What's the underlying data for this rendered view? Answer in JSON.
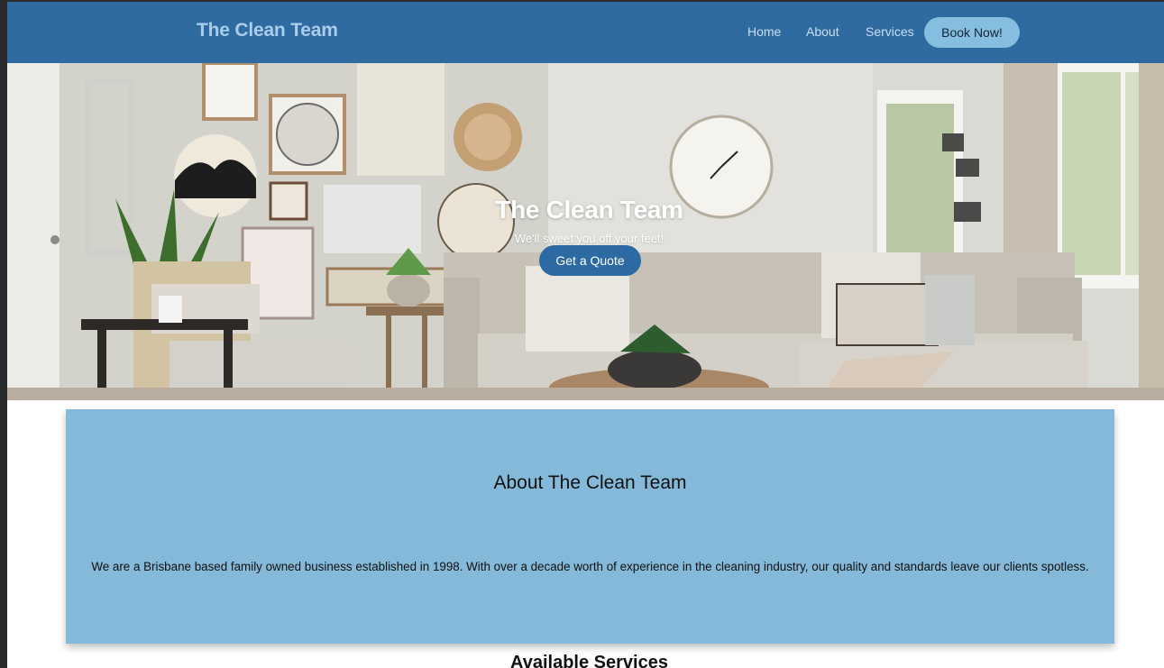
{
  "navbar": {
    "brand": "The Clean Team",
    "links": [
      "Home",
      "About",
      "Services"
    ],
    "cta": "Book Now!"
  },
  "hero": {
    "title": "The Clean Team",
    "subtitle": "We'll sweet you off your feet!",
    "button": "Get a Quote",
    "image": "living-room-photo"
  },
  "about": {
    "title": "About The Clean Team",
    "text": "We are a Brisbane based family owned business established in 1998. With over a decade worth of experience in the cleaning industry, our quality and standards leave our clients spotless."
  },
  "services": {
    "title": "Available Services"
  },
  "colors": {
    "navbar": "#2f6aa1",
    "brand": "#a9cdea",
    "cta": "#86bedf",
    "quote_button": "#2d6aa3",
    "about_panel": "#85b9d9"
  }
}
